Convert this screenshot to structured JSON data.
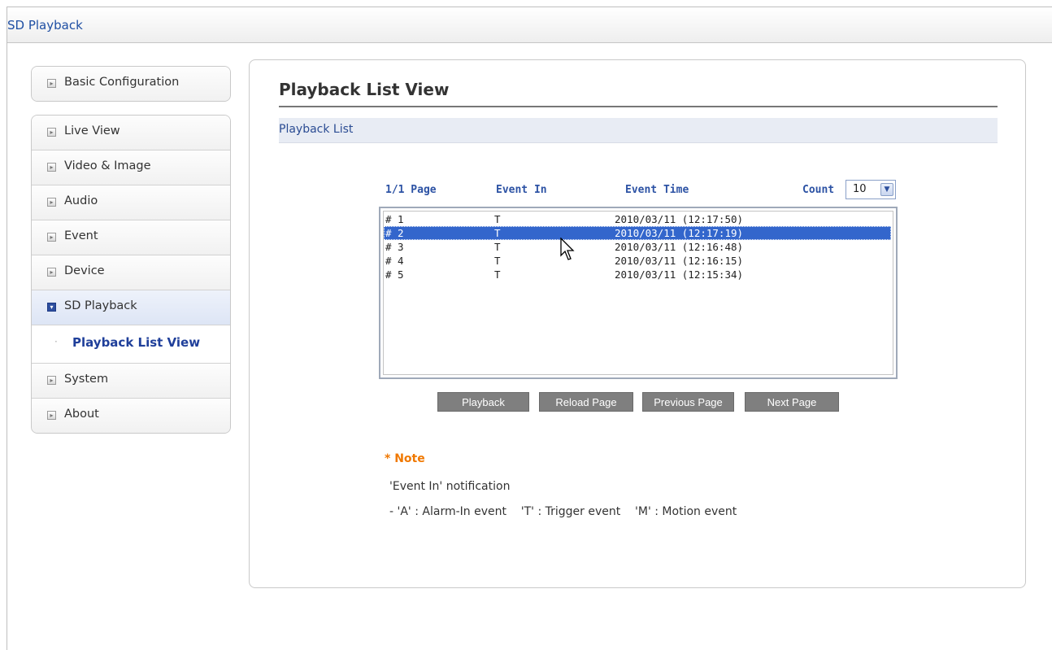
{
  "window": {
    "title": "SD Playback"
  },
  "sidebar": {
    "top_item": "Basic Configuration",
    "items": [
      "Live View",
      "Video & Image",
      "Audio",
      "Event",
      "Device",
      "SD Playback"
    ],
    "active_item": "SD Playback",
    "sub_item": "Playback List View",
    "bottom_items": [
      "System",
      "About"
    ]
  },
  "main": {
    "page_title": "Playback List View",
    "section_title": "Playback List",
    "list_header": {
      "page": "1/1 Page",
      "event_in": "Event In",
      "event_time": "Event Time",
      "count_label": "Count",
      "count_value": "10"
    },
    "rows": [
      {
        "num": "# 1",
        "event": "T",
        "time": "2010/03/11 (12:17:50)",
        "selected": false
      },
      {
        "num": "# 2",
        "event": "T",
        "time": "2010/03/11 (12:17:19)",
        "selected": true
      },
      {
        "num": "# 3",
        "event": "T",
        "time": "2010/03/11 (12:16:48)",
        "selected": false
      },
      {
        "num": "# 4",
        "event": "T",
        "time": "2010/03/11 (12:16:15)",
        "selected": false
      },
      {
        "num": "# 5",
        "event": "T",
        "time": "2010/03/11 (12:15:34)",
        "selected": false
      }
    ],
    "buttons": {
      "playback": "Playback",
      "reload": "Reload Page",
      "previous": "Previous Page",
      "next": "Next Page"
    },
    "note": {
      "title": "* Note",
      "line1": "'Event In' notification",
      "line2": "- 'A' : Alarm-In event    'T' : Trigger event    'M' : Motion event"
    }
  },
  "colors": {
    "accent": "#1f4fa3",
    "selection": "#3366cc",
    "note": "#f07800",
    "button": "#7f7f7f"
  }
}
